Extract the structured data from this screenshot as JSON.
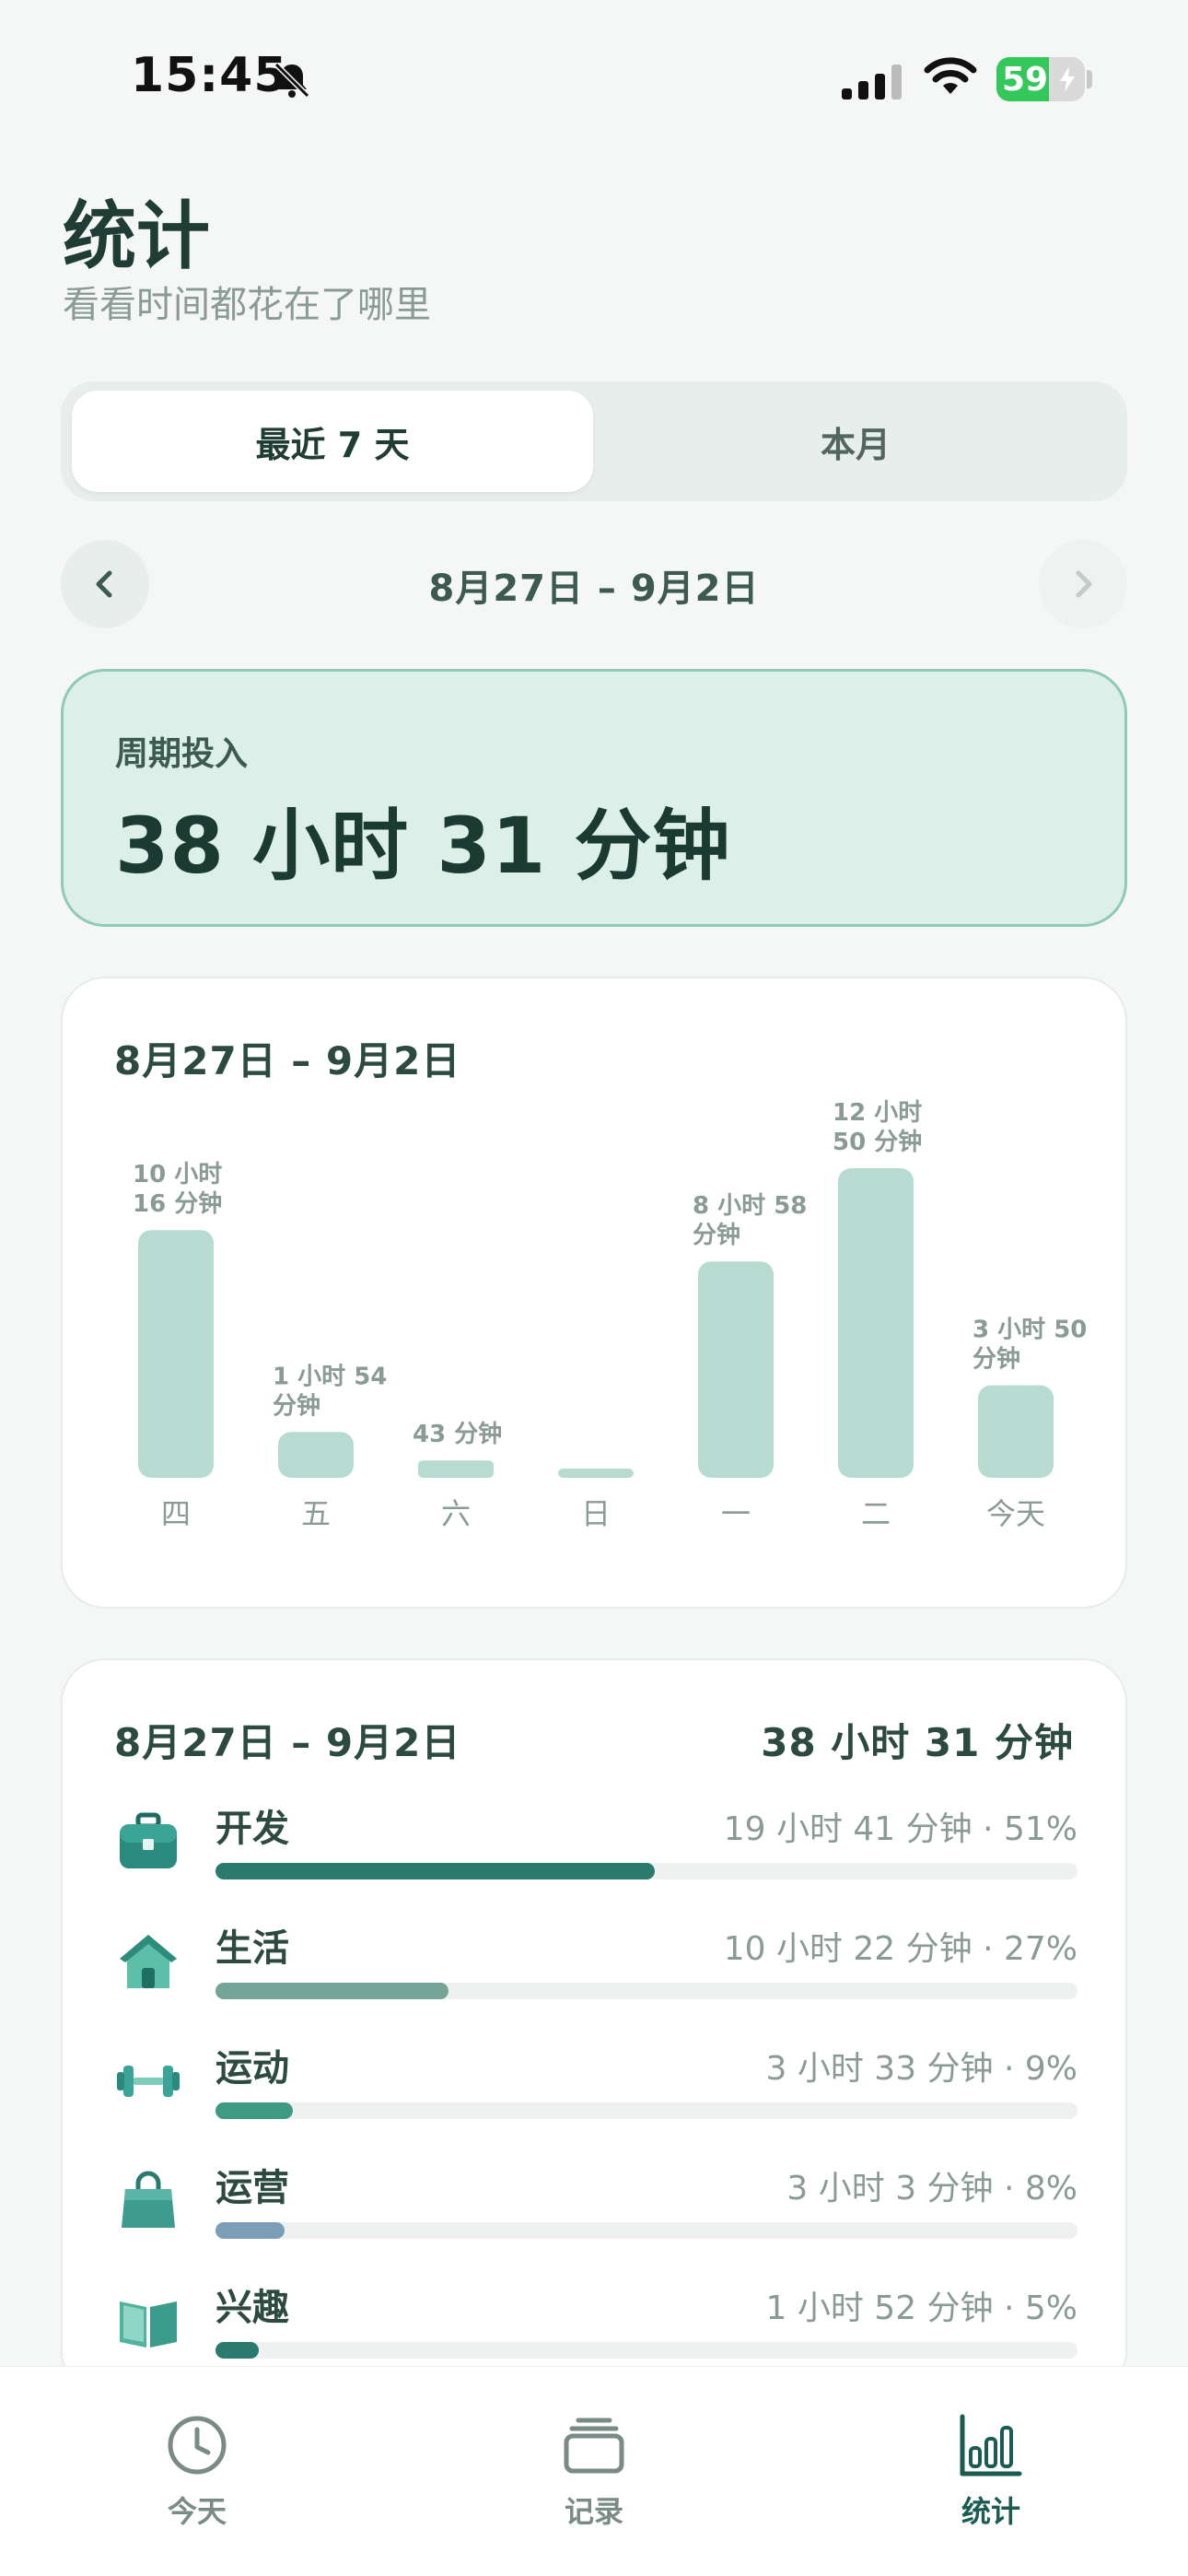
{
  "status_bar": {
    "time": "15:45",
    "battery": "59",
    "battery_level": 0.59
  },
  "header": {
    "title": "统计",
    "subtitle": "看看时间都花在了哪里"
  },
  "segments": {
    "active": "最近 7 天",
    "inactive": "本月"
  },
  "date_nav": {
    "range": "8月27日 – 9月2日"
  },
  "total_card": {
    "label": "周期投入",
    "value": "38 小时 31 分钟"
  },
  "chart_card": {
    "range": "8月27日 – 9月2日"
  },
  "chart_data": {
    "type": "bar",
    "categories": [
      "四",
      "五",
      "六",
      "日",
      "一",
      "二",
      "今天"
    ],
    "values": [
      616,
      114,
      43,
      5,
      538,
      770,
      230
    ],
    "value_labels": [
      [
        "10 小时",
        "16 分钟"
      ],
      [
        "1 小时 54",
        "分钟"
      ],
      [
        "43 分钟"
      ],
      [],
      [
        "8 小时 58",
        "分钟"
      ],
      [
        "12 小时",
        "50 分钟"
      ],
      [
        "3 小时 50",
        "分钟"
      ]
    ],
    "unit": "minutes",
    "bar_color": "#b8dbd1"
  },
  "breakdown": {
    "range": "8月27日 – 9月2日",
    "total": "38 小时 31 分钟",
    "categories": [
      {
        "name": "开发",
        "stat": "19 小时 41 分钟 · 51%",
        "fraction": 0.51,
        "color": "#2a7b6e",
        "icon": "briefcase-icon"
      },
      {
        "name": "生活",
        "stat": "10 小时 22 分钟 · 27%",
        "fraction": 0.27,
        "color": "#76a597",
        "icon": "house-icon"
      },
      {
        "name": "运动",
        "stat": "3 小时 33 分钟 · 9%",
        "fraction": 0.09,
        "color": "#3e9a82",
        "icon": "dumbbell-icon"
      },
      {
        "name": "运营",
        "stat": "3 小时 3 分钟 · 8%",
        "fraction": 0.08,
        "color": "#7b9db5",
        "icon": "shopping-bag-icon"
      },
      {
        "name": "兴趣",
        "stat": "1 小时 52 分钟 · 5%",
        "fraction": 0.05,
        "color": "#2a7b6e",
        "icon": "book-icon"
      }
    ]
  },
  "tab_bar": {
    "tabs": [
      {
        "label": "今天",
        "icon": "clock-icon"
      },
      {
        "label": "记录",
        "icon": "layers-icon"
      },
      {
        "label": "统计",
        "icon": "bar-chart-icon"
      }
    ],
    "active_color": "#1b5c52"
  }
}
